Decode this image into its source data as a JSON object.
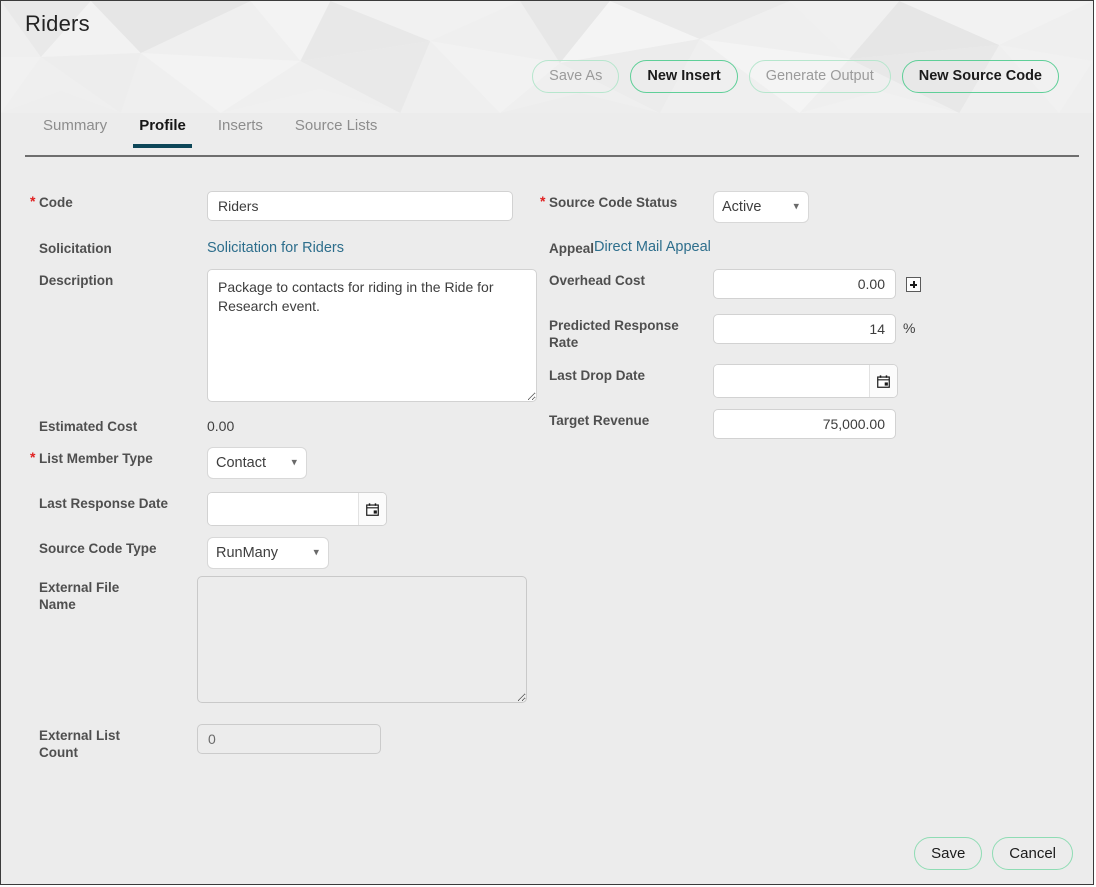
{
  "header": {
    "title": "Riders",
    "actions": [
      {
        "label": "Save As",
        "style": "muted",
        "name": "save-as-button"
      },
      {
        "label": "New Insert",
        "style": "strong",
        "name": "new-insert-button"
      },
      {
        "label": "Generate Output",
        "style": "muted",
        "name": "generate-output-button"
      },
      {
        "label": "New Source Code",
        "style": "strong",
        "name": "new-source-code-button"
      }
    ]
  },
  "tabs": [
    {
      "label": "Summary",
      "active": false
    },
    {
      "label": "Profile",
      "active": true
    },
    {
      "label": "Inserts",
      "active": false
    },
    {
      "label": "Source Lists",
      "active": false
    }
  ],
  "form": {
    "left": {
      "code": {
        "label": "Code",
        "required": true,
        "value": "Riders"
      },
      "solicitation": {
        "label": "Solicitation",
        "link_text": "Solicitation for Riders"
      },
      "description": {
        "label": "Description",
        "value": "Package to contacts for riding in the Ride for Research event."
      },
      "estimated_cost": {
        "label": "Estimated Cost",
        "value": "0.00"
      },
      "list_member_type": {
        "label": "List Member Type",
        "required": true,
        "value": "Contact"
      },
      "last_response_date": {
        "label": "Last Response Date",
        "value": "",
        "icon": "calendar-icon"
      },
      "source_code_type": {
        "label": "Source Code Type",
        "value": "RunMany"
      },
      "external_file_name": {
        "label": "External File Name",
        "value": ""
      },
      "external_list_count": {
        "label": "External List Count",
        "value": "0"
      }
    },
    "right": {
      "source_code_status": {
        "label": "Source Code Status",
        "required": true,
        "value": "Active"
      },
      "appeal": {
        "label": "Appeal",
        "link_text": "Direct Mail Appeal"
      },
      "overhead_cost": {
        "label": "Overhead Cost",
        "value": "0.00",
        "icon": "plus-icon"
      },
      "predicted_response_rate": {
        "label": "Predicted Response Rate",
        "value": "14",
        "unit": "%"
      },
      "last_drop_date": {
        "label": "Last Drop Date",
        "value": "",
        "icon": "calendar-icon"
      },
      "target_revenue": {
        "label": "Target Revenue",
        "value": "75,000.00"
      }
    }
  },
  "footer": {
    "save_label": "Save",
    "cancel_label": "Cancel"
  },
  "colors": {
    "accent_green": "#5fcf98",
    "link_blue": "#2d6e8c",
    "active_tab_underline": "#0d4658",
    "required_star": "#e02020",
    "page_bg": "#ececec"
  }
}
